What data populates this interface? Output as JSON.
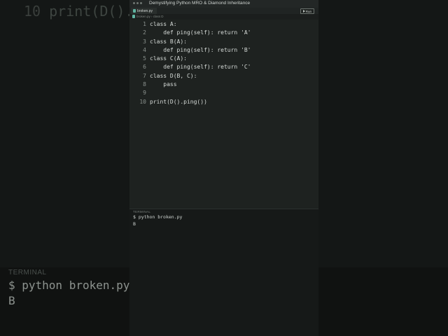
{
  "window": {
    "title": "Demystifying Python MRO & Diamond Inheritance"
  },
  "tab": {
    "label": "broken.py"
  },
  "toolbar": {
    "run_label": "Run"
  },
  "breadcrumb": {
    "text": "broken.py › class D"
  },
  "editor": {
    "lines": [
      {
        "num": "1",
        "text": "class A:"
      },
      {
        "num": "2",
        "text": "    def ping(self): return 'A'"
      },
      {
        "num": "3",
        "text": "class B(A):"
      },
      {
        "num": "4",
        "text": "    def ping(self): return 'B'"
      },
      {
        "num": "5",
        "text": "class C(A):"
      },
      {
        "num": "6",
        "text": "    def ping(self): return 'C'"
      },
      {
        "num": "7",
        "text": "class D(B, C):"
      },
      {
        "num": "8",
        "text": "    pass"
      },
      {
        "num": "9",
        "text": ""
      },
      {
        "num": "10",
        "text": "print(D().ping())"
      }
    ]
  },
  "terminal": {
    "label": "TERMINAL",
    "command": "$ python broken.py",
    "output": "B"
  },
  "background": {
    "code_line": {
      "num": "10",
      "text": "print(D().p"
    },
    "terminal_label": "TERMINAL",
    "terminal_command": "$ python broken.py",
    "terminal_output": "B"
  },
  "colors": {
    "background": "#0d0f0e",
    "editor": "#1e2220",
    "terminal": "#161918",
    "text": "#d6dbd8",
    "line_number": "#8a918d",
    "file_icon": "#5fb3a0"
  }
}
